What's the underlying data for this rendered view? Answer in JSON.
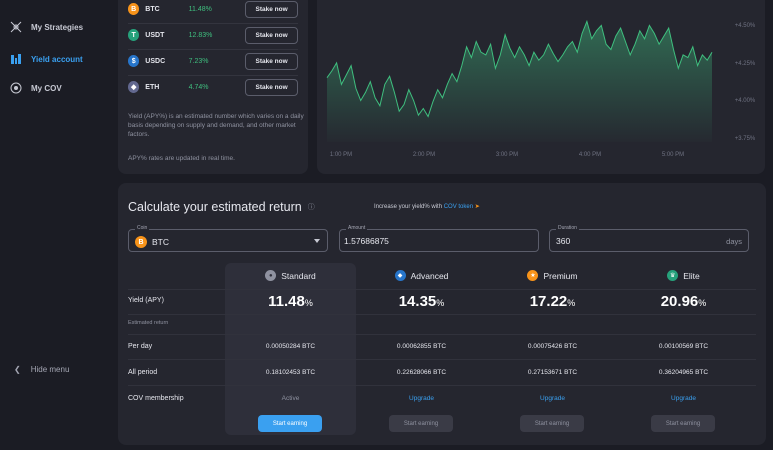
{
  "sidebar": {
    "items": [
      {
        "label": "My Strategies",
        "active": false
      },
      {
        "label": "Yield account",
        "active": true
      },
      {
        "label": "My COV",
        "active": false
      }
    ],
    "hide_menu": "Hide menu"
  },
  "coins": {
    "rows": [
      {
        "symbol": "BTC",
        "apy": "11.48%",
        "button": "Stake now",
        "icon": "bitcoin-icon",
        "color": "#f7931a"
      },
      {
        "symbol": "USDT",
        "apy": "12.83%",
        "button": "Stake now",
        "icon": "tether-icon",
        "color": "#26a17b"
      },
      {
        "symbol": "USDC",
        "apy": "7.23%",
        "button": "Stake now",
        "icon": "usdc-icon",
        "color": "#2775ca"
      },
      {
        "symbol": "ETH",
        "apy": "4.74%",
        "button": "Stake now",
        "icon": "ethereum-icon",
        "color": "#62688f"
      }
    ],
    "note1": "Yield (APY%) is an estimated number which varies on a daily basis depending on supply and demand, and other market factors.",
    "note2": "APY% rates are updated in real time."
  },
  "chart_data": {
    "type": "area",
    "x_ticks": [
      "1:00 PM",
      "2:00 PM",
      "3:00 PM",
      "4:00 PM",
      "5:00 PM"
    ],
    "y_ticks": [
      "+4.50%",
      "+4.25%",
      "+4.00%",
      "+3.75%"
    ],
    "ylim": [
      3.65,
      4.62
    ],
    "color": "#3fbf7f",
    "series": [
      {
        "values": [
          4.13,
          4.18,
          4.24,
          4.08,
          4.15,
          4.22,
          4.05,
          3.96,
          4.02,
          4.1,
          3.98,
          3.92,
          4.08,
          4.14,
          4.02,
          3.88,
          3.93,
          4.04,
          3.96,
          3.85,
          3.9,
          3.84,
          3.95,
          4.04,
          3.98,
          4.08,
          4.16,
          4.1,
          4.22,
          4.36,
          4.28,
          4.4,
          4.32,
          4.3,
          4.38,
          4.2,
          4.3,
          4.45,
          4.35,
          4.28,
          4.36,
          4.3,
          4.22,
          4.32,
          4.26,
          4.3,
          4.38,
          4.31,
          4.25,
          4.3,
          4.36,
          4.4,
          4.32,
          4.46,
          4.55,
          4.42,
          4.48,
          4.52,
          4.38,
          4.34,
          4.44,
          4.5,
          4.4,
          4.3,
          4.38,
          4.48,
          4.42,
          4.52,
          4.46,
          4.38,
          4.44,
          4.5,
          4.34,
          4.2,
          4.3,
          4.28,
          4.36,
          4.22,
          4.3,
          4.26,
          4.32
        ]
      }
    ]
  },
  "calculator": {
    "title": "Calculate your estimated return",
    "promo_text": "Increase your yield% with ",
    "promo_link": "COV token",
    "coin_label": "Coin",
    "coin_value": "BTC",
    "amount_label": "Amount",
    "amount_value": "1.57686875",
    "duration_label": "Duration",
    "duration_value": "360",
    "duration_unit": "days",
    "row_labels": {
      "yield": "Yield (APY)",
      "estimated": "Estimated return",
      "per_day": "Per day",
      "all_period": "All period",
      "membership": "COV membership"
    },
    "plans": [
      {
        "name": "Standard",
        "apy": "11.48",
        "per_day": "0.00050284 BTC",
        "all_period": "0.18102453 BTC",
        "membership": "Active",
        "button": "Start earning"
      },
      {
        "name": "Advanced",
        "apy": "14.35",
        "per_day": "0.00062855 BTC",
        "all_period": "0.22628066 BTC",
        "membership": "Upgrade",
        "button": "Start earning"
      },
      {
        "name": "Premium",
        "apy": "17.22",
        "per_day": "0.00075426 BTC",
        "all_period": "0.27153671 BTC",
        "membership": "Upgrade",
        "button": "Start earning"
      },
      {
        "name": "Elite",
        "apy": "20.96",
        "per_day": "0.00100569 BTC",
        "all_period": "0.36204965 BTC",
        "membership": "Upgrade",
        "button": "Start earning"
      }
    ],
    "apy_unit": "%"
  }
}
